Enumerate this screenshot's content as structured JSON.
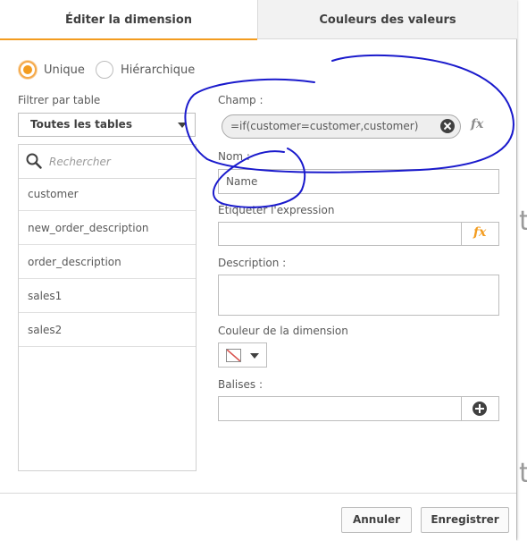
{
  "tabs": [
    {
      "label": "Éditer la dimension",
      "active": true
    },
    {
      "label": "Couleurs des valeurs",
      "active": false
    }
  ],
  "dimension_type": {
    "options": [
      {
        "label": "Unique",
        "selected": true
      },
      {
        "label": "Hiérarchique",
        "selected": false
      }
    ]
  },
  "left_panel": {
    "filter_label": "Filtrer par table",
    "table_select_value": "Toutes les tables",
    "search_placeholder": "Rechercher",
    "fields": [
      "customer",
      "new_order_description",
      "order_description",
      "sales1",
      "sales2"
    ]
  },
  "form": {
    "field_label": "Champ :",
    "field_expression": "=if(customer=customer,customer)",
    "name_label": "Nom :",
    "name_value": "Name",
    "label_expr_label": "Étiqueter l'expression",
    "label_expr_value": "",
    "description_label": "Description :",
    "description_value": "",
    "color_label": "Couleur de la dimension",
    "tags_label": "Balises :",
    "tags_value": "",
    "fx_text": "fx"
  },
  "footer": {
    "cancel_label": "Annuler",
    "save_label": "Enregistrer"
  },
  "background": {
    "ghost_text_1": "t",
    "ghost_text_2": "t"
  },
  "colors": {
    "accent": "#f39c1f",
    "annotation_ink": "#1a1acc",
    "border": "#bdbdbd",
    "text": "#595959"
  },
  "icons": {
    "search": "search-icon",
    "clear": "clear-circle-icon",
    "fx": "fx-icon",
    "add": "plus-circle-icon",
    "caret": "chevron-down-icon",
    "swatch": "no-color-swatch-icon"
  }
}
